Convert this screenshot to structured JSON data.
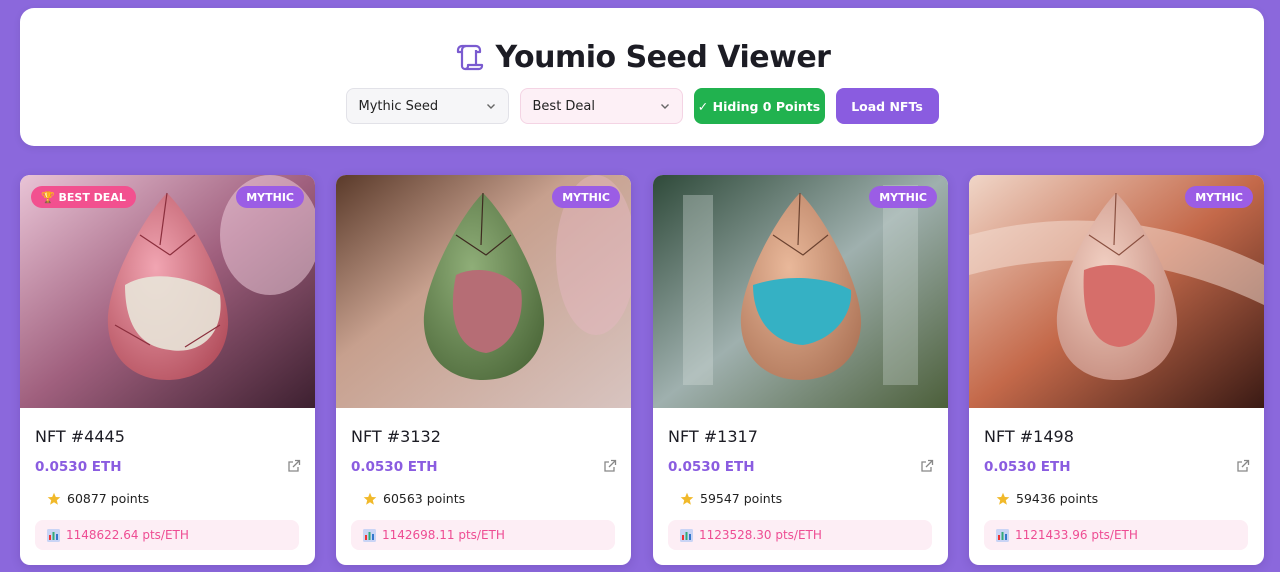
{
  "header": {
    "title": "Youmio Seed Viewer",
    "icon": "scroll-icon",
    "seed_select": "Mythic Seed",
    "sort_select": "Best Deal",
    "hide_button": "✓ Hiding 0 Points",
    "load_button": "Load NFTs"
  },
  "colors": {
    "background": "#8b68dc",
    "accent_purple": "#8a5ce0",
    "green": "#21b24f",
    "pink": "#ee4c93"
  },
  "cards": [
    {
      "title": "NFT #4445",
      "price": "0.0530 ETH",
      "points": "60877 points",
      "ratio": "1148622.64 pts/ETH",
      "rarity": "MYTHIC",
      "deal": "🏆 BEST DEAL"
    },
    {
      "title": "NFT #3132",
      "price": "0.0530 ETH",
      "points": "60563 points",
      "ratio": "1142698.11 pts/ETH",
      "rarity": "MYTHIC"
    },
    {
      "title": "NFT #1317",
      "price": "0.0530 ETH",
      "points": "59547 points",
      "ratio": "1123528.30 pts/ETH",
      "rarity": "MYTHIC"
    },
    {
      "title": "NFT #1498",
      "price": "0.0530 ETH",
      "points": "59436 points",
      "ratio": "1121433.96 pts/ETH",
      "rarity": "MYTHIC"
    }
  ]
}
